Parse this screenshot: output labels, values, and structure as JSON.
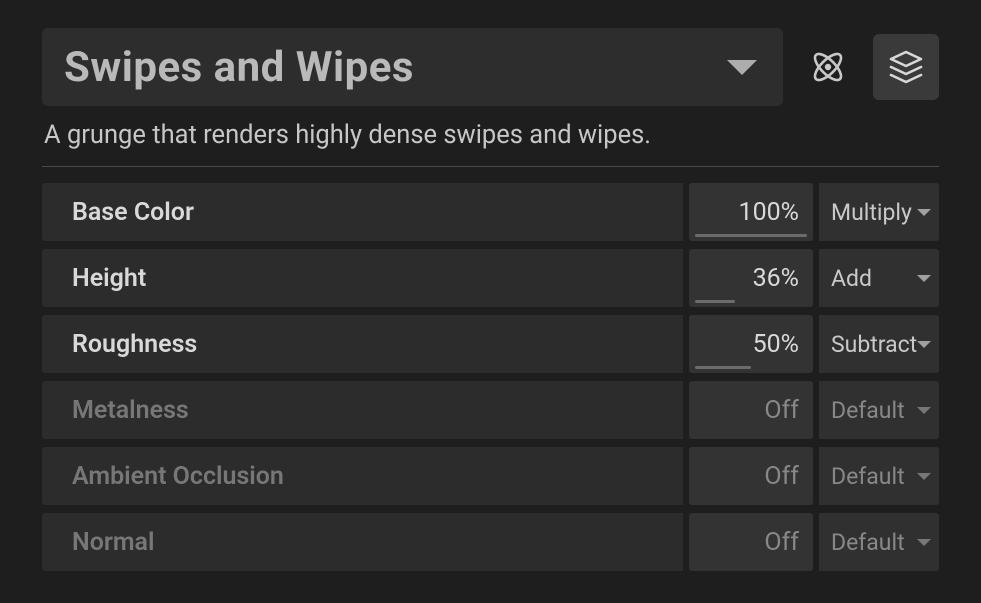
{
  "header": {
    "title": "Swipes and Wipes",
    "description": "A grunge that renders highly dense swipes and wipes."
  },
  "channels": [
    {
      "name": "Base Color",
      "value": "100%",
      "mode": "Multiply",
      "enabled": true,
      "fill": 112
    },
    {
      "name": "Height",
      "value": "36%",
      "mode": "Add",
      "enabled": true,
      "fill": 40
    },
    {
      "name": "Roughness",
      "value": "50%",
      "mode": "Subtract",
      "enabled": true,
      "fill": 56
    },
    {
      "name": "Metalness",
      "value": "Off",
      "mode": "Default",
      "enabled": false,
      "fill": 0
    },
    {
      "name": "Ambient Occlusion",
      "value": "Off",
      "mode": "Default",
      "enabled": false,
      "fill": 0
    },
    {
      "name": "Normal",
      "value": "Off",
      "mode": "Default",
      "enabled": false,
      "fill": 0
    }
  ]
}
